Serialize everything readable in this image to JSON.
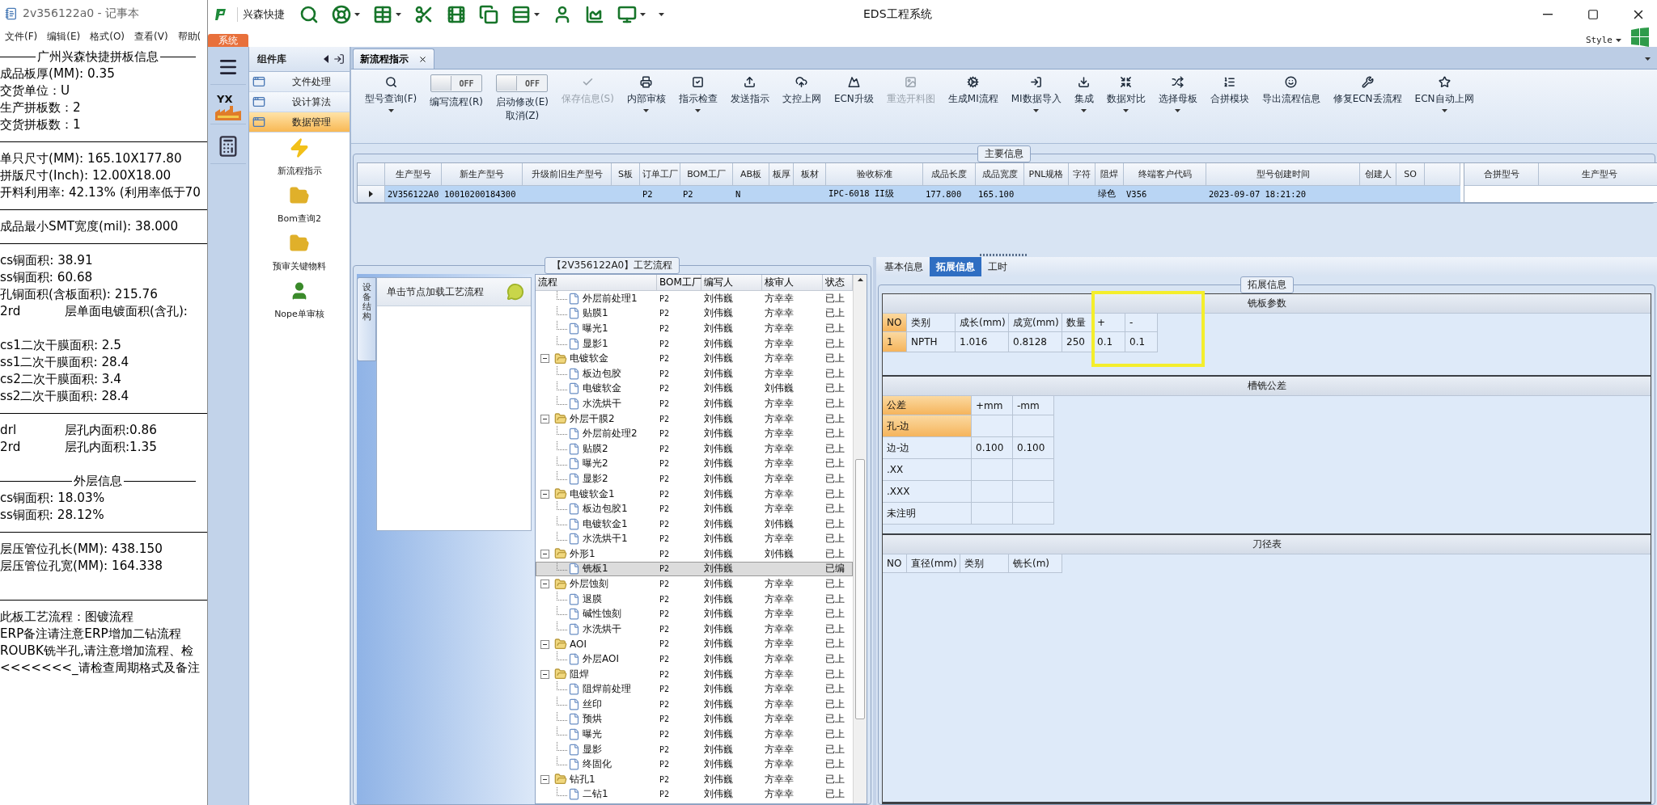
{
  "notepad": {
    "title": "2v356122a0 - 记事本",
    "menu": [
      "文件(F)",
      "编辑(E)",
      "格式(O)",
      "查看(V)",
      "帮助("
    ],
    "lines": [
      {
        "kind": "heading",
        "text": "广州兴森快捷拼板信息"
      },
      {
        "kind": "text",
        "text": "成品板厚(MM): 0.35"
      },
      {
        "kind": "text",
        "text": "交货单位：U"
      },
      {
        "kind": "text",
        "text": "生产拼板数：2"
      },
      {
        "kind": "text",
        "text": "交货拼板数：1"
      },
      {
        "kind": "rule"
      },
      {
        "kind": "text",
        "text": "单只尺寸(MM): 165.10X177.80"
      },
      {
        "kind": "text",
        "text": "拼版尺寸(Inch): 12.00X18.00"
      },
      {
        "kind": "text",
        "text": "开料利用率: 42.13% (利用率低于70"
      },
      {
        "kind": "rule"
      },
      {
        "kind": "text",
        "text": "成品最小SMT宽度(mil): 38.000"
      },
      {
        "kind": "rule"
      },
      {
        "kind": "text",
        "text": "cs铜面积: 38.91"
      },
      {
        "kind": "text",
        "text": "ss铜面积: 60.68"
      },
      {
        "kind": "text",
        "text": "孔铜面积(含板面积): 215.76"
      },
      {
        "kind": "pair",
        "left": "2rd",
        "right": "层单面电镀面积(含孔):"
      },
      {
        "kind": "blank"
      },
      {
        "kind": "text",
        "text": "cs1二次干膜面积: 2.5"
      },
      {
        "kind": "text",
        "text": "ss1二次干膜面积: 28.4"
      },
      {
        "kind": "text",
        "text": "cs2二次干膜面积: 3.4"
      },
      {
        "kind": "text",
        "text": "ss2二次干膜面积: 28.4"
      },
      {
        "kind": "rule"
      },
      {
        "kind": "pair",
        "left": "drl",
        "right": "层孔内面积:0.86"
      },
      {
        "kind": "pair",
        "left": "2rd",
        "right": "层孔内面积:1.35"
      },
      {
        "kind": "blank"
      },
      {
        "kind": "heading",
        "text": "外层信息"
      },
      {
        "kind": "text",
        "text": "cs铜面积: 18.03%"
      },
      {
        "kind": "text",
        "text": "ss铜面积: 28.12%"
      },
      {
        "kind": "rule"
      },
      {
        "kind": "text",
        "text": "层压管位孔长(MM): 438.150"
      },
      {
        "kind": "text",
        "text": "层压管位孔宽(MM): 164.338"
      },
      {
        "kind": "blank"
      },
      {
        "kind": "rule"
      },
      {
        "kind": "text",
        "text": "此板工艺流程：图镀流程"
      },
      {
        "kind": "text",
        "text": "ERP备注请注意ERP增加二钻流程"
      },
      {
        "kind": "text",
        "text": "ROUBK铣半孔,请注意增加流程、检"
      },
      {
        "kind": "text",
        "text": "<<<<<<<_请检查周期格式及备注"
      }
    ]
  },
  "app": {
    "brand": "兴森快捷",
    "title": "EDS工程系统",
    "system_tab": "系统",
    "style_label": "Style",
    "logo_text": "YX"
  },
  "sidebar": {
    "title": "组件库",
    "items": [
      {
        "label": "文件处理",
        "selected": false
      },
      {
        "label": "设计算法",
        "selected": false
      },
      {
        "label": "数据管理",
        "selected": true
      }
    ],
    "tools": [
      "新流程指示",
      "Bom查询2",
      "预审关键物料",
      "Nope单审核"
    ]
  },
  "doc_tab": {
    "label": "新流程指示"
  },
  "ribbon": [
    {
      "kind": "button",
      "label": "型号查询(F)",
      "disabled": false,
      "dropdown": true
    },
    {
      "kind": "toggle",
      "label": "编写流程(R)",
      "state": "OFF",
      "on": false
    },
    {
      "kind": "toggle",
      "label": "启动修改(E)\n取消(Z)",
      "state": "OFF",
      "on": false
    },
    {
      "kind": "button",
      "label": "保存信息(S)",
      "disabled": true,
      "dropdown": false
    },
    {
      "kind": "button",
      "label": "内部审核",
      "disabled": false,
      "dropdown": true
    },
    {
      "kind": "button",
      "label": "指示检查",
      "disabled": false,
      "dropdown": true
    },
    {
      "kind": "button",
      "label": "发送指示",
      "disabled": false,
      "dropdown": false
    },
    {
      "kind": "button",
      "label": "文控上网",
      "disabled": false,
      "dropdown": false
    },
    {
      "kind": "button",
      "label": "ECN升级",
      "disabled": false,
      "dropdown": false
    },
    {
      "kind": "button",
      "label": "重选开料图",
      "disabled": true,
      "dropdown": false
    },
    {
      "kind": "button",
      "label": "生成MI流程",
      "disabled": false,
      "dropdown": false
    },
    {
      "kind": "button",
      "label": "MI数据导入",
      "disabled": false,
      "dropdown": true
    },
    {
      "kind": "button",
      "label": "集成",
      "disabled": false,
      "dropdown": true
    },
    {
      "kind": "button",
      "label": "数据对比",
      "disabled": false,
      "dropdown": true
    },
    {
      "kind": "button",
      "label": "选择母板",
      "disabled": false,
      "dropdown": true
    },
    {
      "kind": "button",
      "label": "合拼模块",
      "disabled": false,
      "dropdown": false
    },
    {
      "kind": "button",
      "label": "导出流程信息",
      "disabled": false,
      "dropdown": false
    },
    {
      "kind": "button",
      "label": "修复ECN丢流程",
      "disabled": false,
      "dropdown": false
    },
    {
      "kind": "button",
      "label": "ECN自动上网",
      "disabled": false,
      "dropdown": true
    }
  ],
  "main_info": {
    "title": "主要信息",
    "columns": [
      "生产型号",
      "新生产型号",
      "升级前旧生产型号",
      "S板",
      "订单工厂",
      "BOM工厂",
      "AB板",
      "板厚",
      "板材",
      "验收标准",
      "成品长度",
      "成品宽度",
      "PNL规格",
      "字符",
      "阻焊",
      "终端客户代码",
      "型号创建时间",
      "创建人",
      "SO"
    ],
    "rows": [
      {
        "selected": true,
        "cells": [
          "2V356122A0",
          "10010200184300",
          null,
          null,
          "P2",
          "P2",
          "N",
          null,
          null,
          "IPC-6018 II级",
          "177.800",
          "165.100",
          null,
          null,
          "绿色",
          "V356",
          "2023-09-07 18:21:20",
          null,
          null
        ]
      }
    ],
    "merge_columns": [
      "合拼型号",
      "生产型号"
    ]
  },
  "process": {
    "title": "【2V356122A0】工艺流程",
    "side_tab": "设备结构",
    "hint": "单击节点加载工艺流程",
    "columns": [
      "流程",
      "BOM工厂",
      "编写人",
      "核审人",
      "状态"
    ],
    "tree": [
      {
        "children": [
          {
            "label": "外层前处理1",
            "bom": "P2",
            "author": "刘伟巍",
            "reviewer": "方幸幸",
            "status": "已上",
            "selected": false
          },
          {
            "label": "贴膜1",
            "bom": "P2",
            "author": "刘伟巍",
            "reviewer": "方幸幸",
            "status": "已上",
            "selected": false
          },
          {
            "label": "曝光1",
            "bom": "P2",
            "author": "刘伟巍",
            "reviewer": "方幸幸",
            "status": "已上",
            "selected": false
          },
          {
            "label": "显影1",
            "bom": "P2",
            "author": "刘伟巍",
            "reviewer": "方幸幸",
            "status": "已上",
            "selected": false
          }
        ]
      },
      {
        "label": "电镀软金",
        "bom": "P2",
        "author": "刘伟巍",
        "reviewer": "方幸幸",
        "status": "已上",
        "expanded": true,
        "selected": false,
        "children": [
          {
            "label": "板边包胶",
            "bom": "P2",
            "author": "刘伟巍",
            "reviewer": "方幸幸",
            "status": "已上",
            "selected": false
          },
          {
            "label": "电镀软金",
            "bom": "P2",
            "author": "刘伟巍",
            "reviewer": "刘伟巍",
            "status": "已上",
            "selected": false
          },
          {
            "label": "水洗烘干",
            "bom": "P2",
            "author": "刘伟巍",
            "reviewer": "方幸幸",
            "status": "已上",
            "selected": false
          }
        ]
      },
      {
        "label": "外层干膜2",
        "bom": "P2",
        "author": "刘伟巍",
        "reviewer": "方幸幸",
        "status": "已上",
        "expanded": true,
        "selected": false,
        "children": [
          {
            "label": "外层前处理2",
            "bom": "P2",
            "author": "刘伟巍",
            "reviewer": "方幸幸",
            "status": "已上",
            "selected": false
          },
          {
            "label": "贴膜2",
            "bom": "P2",
            "author": "刘伟巍",
            "reviewer": "方幸幸",
            "status": "已上",
            "selected": false
          },
          {
            "label": "曝光2",
            "bom": "P2",
            "author": "刘伟巍",
            "reviewer": "方幸幸",
            "status": "已上",
            "selected": false
          },
          {
            "label": "显影2",
            "bom": "P2",
            "author": "刘伟巍",
            "reviewer": "方幸幸",
            "status": "已上",
            "selected": false
          }
        ]
      },
      {
        "label": "电镀软金1",
        "bom": "P2",
        "author": "刘伟巍",
        "reviewer": "方幸幸",
        "status": "已上",
        "expanded": true,
        "selected": false,
        "children": [
          {
            "label": "板边包胶1",
            "bom": "P2",
            "author": "刘伟巍",
            "reviewer": "方幸幸",
            "status": "已上",
            "selected": false
          },
          {
            "label": "电镀软金1",
            "bom": "P2",
            "author": "刘伟巍",
            "reviewer": "刘伟巍",
            "status": "已上",
            "selected": false
          },
          {
            "label": "水洗烘干1",
            "bom": "P2",
            "author": "刘伟巍",
            "reviewer": "方幸幸",
            "status": "已上",
            "selected": false
          }
        ]
      },
      {
        "label": "外形1",
        "bom": "P2",
        "author": "刘伟巍",
        "reviewer": "刘伟巍",
        "status": "已上",
        "expanded": true,
        "selected": false,
        "children": [
          {
            "label": "铣板1",
            "bom": "P2",
            "author": "刘伟巍",
            "status": "已编",
            "selected": true
          }
        ]
      },
      {
        "label": "外层蚀刻",
        "bom": "P2",
        "author": "刘伟巍",
        "reviewer": "方幸幸",
        "status": "已上",
        "expanded": true,
        "selected": false,
        "children": [
          {
            "label": "退膜",
            "bom": "P2",
            "author": "刘伟巍",
            "reviewer": "方幸幸",
            "status": "已上",
            "selected": false
          },
          {
            "label": "碱性蚀刻",
            "bom": "P2",
            "author": "刘伟巍",
            "reviewer": "方幸幸",
            "status": "已上",
            "selected": false
          },
          {
            "label": "水洗烘干",
            "bom": "P2",
            "author": "刘伟巍",
            "reviewer": "方幸幸",
            "status": "已上",
            "selected": false
          }
        ]
      },
      {
        "label": "AOI",
        "bom": "P2",
        "author": "刘伟巍",
        "reviewer": "方幸幸",
        "status": "已上",
        "expanded": true,
        "selected": false,
        "children": [
          {
            "label": "外层AOI",
            "bom": "P2",
            "author": "刘伟巍",
            "reviewer": "方幸幸",
            "status": "已上",
            "selected": false
          }
        ]
      },
      {
        "label": "阻焊",
        "bom": "P2",
        "author": "刘伟巍",
        "reviewer": "方幸幸",
        "status": "已上",
        "expanded": true,
        "selected": false,
        "children": [
          {
            "label": "阻焊前处理",
            "bom": "P2",
            "author": "刘伟巍",
            "reviewer": "方幸幸",
            "status": "已上",
            "selected": false
          },
          {
            "label": "丝印",
            "bom": "P2",
            "author": "刘伟巍",
            "reviewer": "方幸幸",
            "status": "已上",
            "selected": false
          },
          {
            "label": "预烘",
            "bom": "P2",
            "author": "刘伟巍",
            "reviewer": "方幸幸",
            "status": "已上",
            "selected": false
          },
          {
            "label": "曝光",
            "bom": "P2",
            "author": "刘伟巍",
            "reviewer": "方幸幸",
            "status": "已上",
            "selected": false
          },
          {
            "label": "显影",
            "bom": "P2",
            "author": "刘伟巍",
            "reviewer": "方幸幸",
            "status": "已上",
            "selected": false
          },
          {
            "label": "终固化",
            "bom": "P2",
            "author": "刘伟巍",
            "reviewer": "方幸幸",
            "status": "已上",
            "selected": false
          }
        ]
      },
      {
        "label": "钻孔1",
        "bom": "P2",
        "author": "刘伟巍",
        "reviewer": "方幸幸",
        "status": "已上",
        "expanded": true,
        "selected": false,
        "children": [
          {
            "label": "二钻1",
            "bom": "P2",
            "author": "刘伟巍",
            "reviewer": "方幸幸",
            "status": "已上",
            "selected": false
          }
        ]
      }
    ]
  },
  "details": {
    "tabs": [
      {
        "label": "基本信息",
        "selected": false
      },
      {
        "label": "拓展信息",
        "selected": true
      },
      {
        "label": "工时",
        "selected": false
      }
    ],
    "group_title": "拓展信息",
    "sections": [
      {
        "title": "铣板参数",
        "focused": true,
        "columns": [
          "NO",
          "类别",
          "成长(mm)",
          "成宽(mm)",
          "数量",
          "+",
          "-"
        ],
        "rows": [
          {
            "selected": true,
            "cells": [
              "1",
              "NPTH",
              "1.016",
              "0.8128",
              "250",
              "0.1",
              "0.1"
            ]
          }
        ]
      },
      {
        "title": "槽铣公差",
        "focused": true,
        "columns": [
          "公差",
          "+mm",
          "-mm"
        ],
        "rows": [
          {
            "selected": true,
            "cells": [
              "孔-边",
              null,
              null
            ]
          },
          {
            "selected": false,
            "cells": [
              "边-边",
              "0.100",
              "0.100"
            ]
          },
          {
            "selected": false,
            "cells": [
              ".XX",
              null,
              null
            ]
          },
          {
            "selected": false,
            "cells": [
              ".XXX",
              null,
              null
            ]
          },
          {
            "selected": false,
            "cells": [
              "未注明",
              null,
              null
            ]
          }
        ]
      },
      {
        "title": "刀径表",
        "focused": false,
        "columns": [
          "NO",
          "直径(mm)",
          "类别",
          "铣长(m)"
        ]
      }
    ]
  }
}
